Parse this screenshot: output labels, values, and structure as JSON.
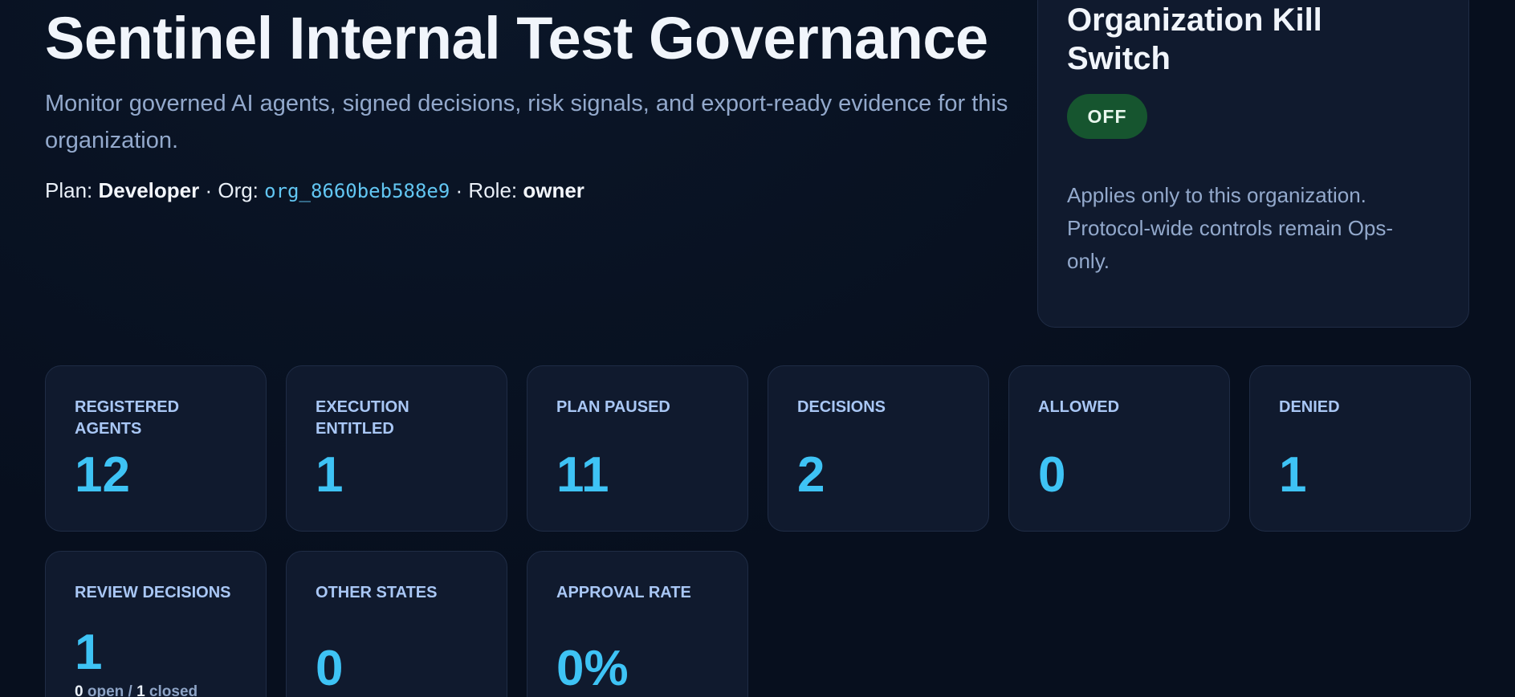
{
  "header": {
    "title": "Sentinel Internal Test Governance",
    "subtitle": "Monitor governed AI agents, signed decisions, risk signals, and export-ready evidence for this organization.",
    "plan_label": "Plan: ",
    "plan_value": "Developer",
    "org_label": " · Org: ",
    "org_value": "org_8660beb588e9",
    "role_label": " · Role: ",
    "role_value": "owner"
  },
  "kill_switch": {
    "title": "Organization Kill Switch",
    "state": "OFF",
    "note": "Applies only to this organization. Protocol-wide controls remain Ops-only."
  },
  "stats": {
    "registered_agents": {
      "label": "Registered Agents",
      "value": "12"
    },
    "execution_entitled": {
      "label": "Execution Entitled",
      "value": "1"
    },
    "plan_paused": {
      "label": "Plan Paused",
      "value": "11"
    },
    "decisions": {
      "label": "Decisions",
      "value": "2"
    },
    "allowed": {
      "label": "Allowed",
      "value": "0"
    },
    "denied": {
      "label": "Denied",
      "value": "1"
    },
    "review_decisions": {
      "label": "Review Decisions",
      "value": "1",
      "open_count": "0",
      "open_label": " open / ",
      "closed_count": "1",
      "closed_label": " closed"
    },
    "other_states": {
      "label": "Other States",
      "value": "0"
    },
    "approval_rate": {
      "label": "Approval Rate",
      "value": "0%"
    }
  },
  "colors": {
    "background": "#070f1e",
    "card": "#101a2e",
    "accent_value": "#3ec3f5",
    "label": "#a9c7f5",
    "muted_text": "#93a9cc",
    "kill_off_badge": "#16552f"
  }
}
